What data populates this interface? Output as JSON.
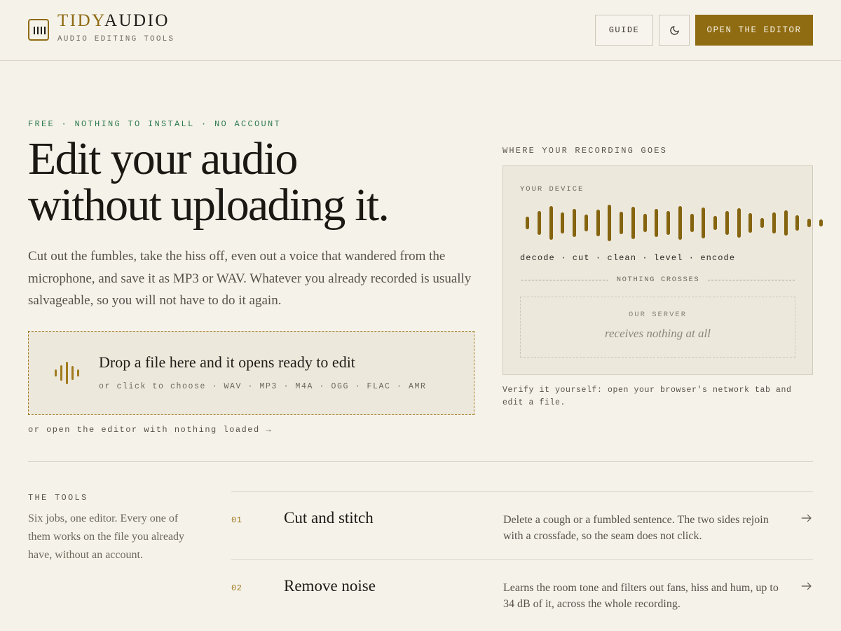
{
  "header": {
    "brand_part1": "TIDY",
    "brand_part2": "AUDIO",
    "tagline": "AUDIO EDITING TOOLS",
    "guide_label": "GUIDE",
    "theme_icon": "moon-icon",
    "open_label": "OPEN THE EDITOR"
  },
  "hero": {
    "eyebrow": "FREE · NOTHING TO INSTALL · NO ACCOUNT",
    "headline_line1": "Edit your audio",
    "headline_line2": "without uploading it.",
    "lead": "Cut out the fumbles, take the hiss off, even out a voice that wandered from the microphone, and save it as MP3 or WAV. Whatever you already recorded is usually salvageable, so you will not have to do it again.",
    "drop_title": "Drop a file here and it opens ready to edit",
    "drop_sub": "or click to choose · WAV · MP3 · M4A · OGG · FLAC · AMR",
    "empty_link": "or open the editor with nothing loaded →"
  },
  "flow": {
    "label": "WHERE YOUR RECORDING GOES",
    "device_label": "YOUR DEVICE",
    "steps": "decode · cut · clean · level · encode",
    "divider_label": "NOTHING CROSSES",
    "server_label": "OUR SERVER",
    "server_note": "receives nothing at all",
    "verify": "Verify it yourself: open your browser's network tab and edit a file."
  },
  "tools": {
    "label": "THE TOOLS",
    "description": "Six jobs, one editor. Every one of them works on the file you already have, without an account.",
    "items": [
      {
        "num": "01",
        "name": "Cut and stitch",
        "text": "Delete a cough or a fumbled sentence. The two sides rejoin with a crossfade, so the seam does not click."
      },
      {
        "num": "02",
        "name": "Remove noise",
        "text": "Learns the room tone and filters out fans, hiss and hum, up to 34 dB of it, across the whole recording."
      }
    ]
  },
  "colors": {
    "accent": "#8f6b12",
    "background": "#f5f2ea",
    "panel": "#ede8dc",
    "eyebrow": "#2d7a4f"
  }
}
